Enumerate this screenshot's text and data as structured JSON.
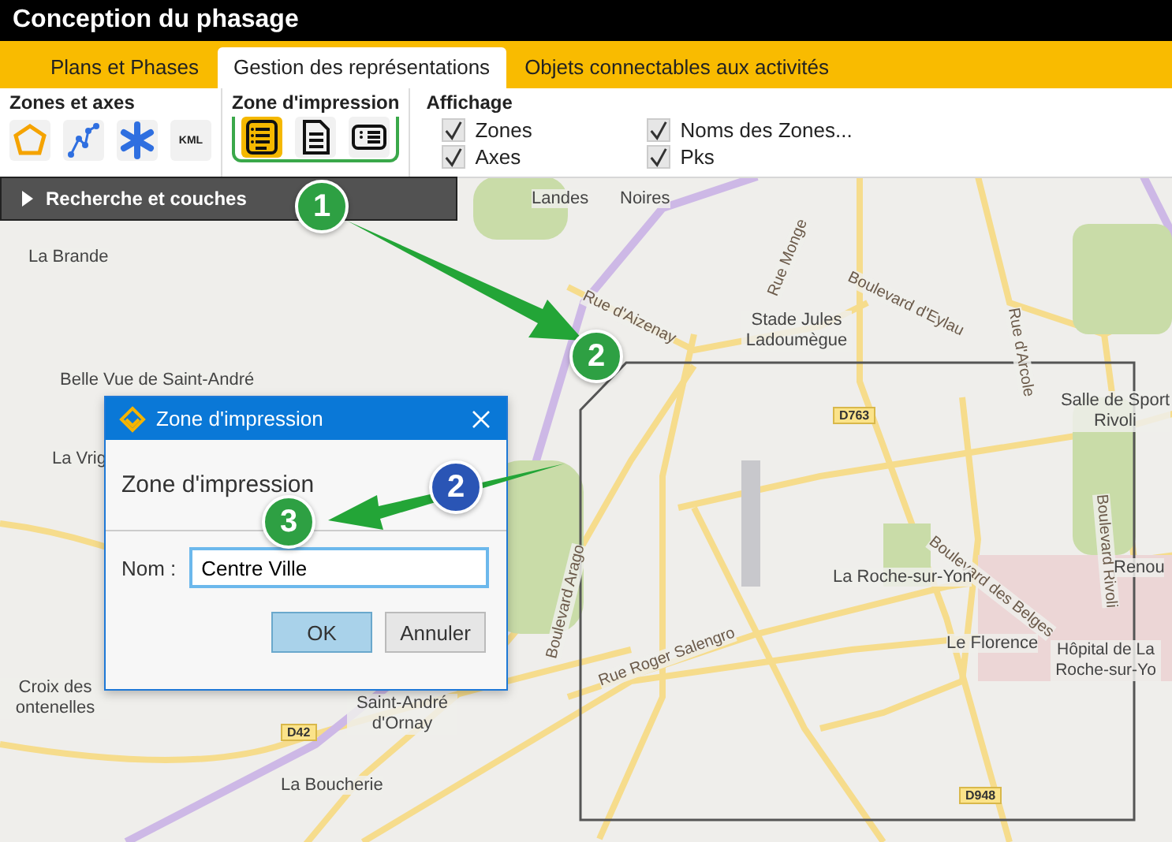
{
  "window": {
    "title": "Conception du phasage"
  },
  "tabs": [
    {
      "label": "Plans et Phases",
      "selected": false
    },
    {
      "label": "Gestion des représentations",
      "selected": true
    },
    {
      "label": "Objets connectables aux activités",
      "selected": false
    }
  ],
  "ribbon": {
    "zones_axes": {
      "title": "Zones et axes",
      "kml_label": "KML"
    },
    "print_zone": {
      "title": "Zone d'impression",
      "buttons": [
        {
          "selected": true
        },
        {
          "selected": false
        },
        {
          "selected": false
        }
      ]
    },
    "display": {
      "title": "Affichage",
      "options": [
        {
          "label": "Zones",
          "checked": true
        },
        {
          "label": "Noms des Zones...",
          "checked": true
        },
        {
          "label": "Axes",
          "checked": true
        },
        {
          "label": "Pks",
          "checked": true
        }
      ]
    }
  },
  "search_panel": {
    "label": "Recherche et couches",
    "expanded": false
  },
  "map_labels": [
    {
      "text": "Landes",
      "kind": "place"
    },
    {
      "text": "Noires",
      "kind": "place"
    },
    {
      "text": "La Brande",
      "kind": "place"
    },
    {
      "text": "Rue d'Aizenay",
      "kind": "street"
    },
    {
      "text": "Stade Jules Ladoumègue",
      "kind": "place"
    },
    {
      "text": "Boulevard d'Eylau",
      "kind": "street"
    },
    {
      "text": "Rue d'Arcole",
      "kind": "street"
    },
    {
      "text": "Rue Monge",
      "kind": "street"
    },
    {
      "text": "Belle Vue de Saint-André",
      "kind": "place"
    },
    {
      "text": "La Vrig",
      "kind": "place"
    },
    {
      "text": "D763",
      "kind": "road"
    },
    {
      "text": "Salle de Sport Rivoli",
      "kind": "place"
    },
    {
      "text": "Boulevard des Belges",
      "kind": "street"
    },
    {
      "text": "Boulevard Rivoli",
      "kind": "street"
    },
    {
      "text": "Renou",
      "kind": "place"
    },
    {
      "text": "La Roche-sur-Yon",
      "kind": "place"
    },
    {
      "text": "Le Florence",
      "kind": "place"
    },
    {
      "text": "Hôpital de La Roche-sur-Yo",
      "kind": "place"
    },
    {
      "text": "Boulevard Arago",
      "kind": "street"
    },
    {
      "text": "Rue Roger Salengro",
      "kind": "street"
    },
    {
      "text": "Croix des ontenelles",
      "kind": "place"
    },
    {
      "text": "Saint-André d'Ornay",
      "kind": "place"
    },
    {
      "text": "D42",
      "kind": "road"
    },
    {
      "text": "La Boucherie",
      "kind": "place"
    },
    {
      "text": "D948",
      "kind": "road"
    }
  ],
  "dialog": {
    "title": "Zone d'impression",
    "heading": "Zone d'impression",
    "field_label": "Nom :",
    "field_value": "Centre Ville",
    "buttons": [
      {
        "label": "OK",
        "default": true
      },
      {
        "label": "Annuler",
        "default": false
      }
    ]
  },
  "callouts": [
    {
      "number": "1",
      "color": "#2ea043"
    },
    {
      "number": "2",
      "color": "#2ea043"
    },
    {
      "number": "2",
      "color": "#2a55b5"
    },
    {
      "number": "3",
      "color": "#2ea043"
    }
  ]
}
